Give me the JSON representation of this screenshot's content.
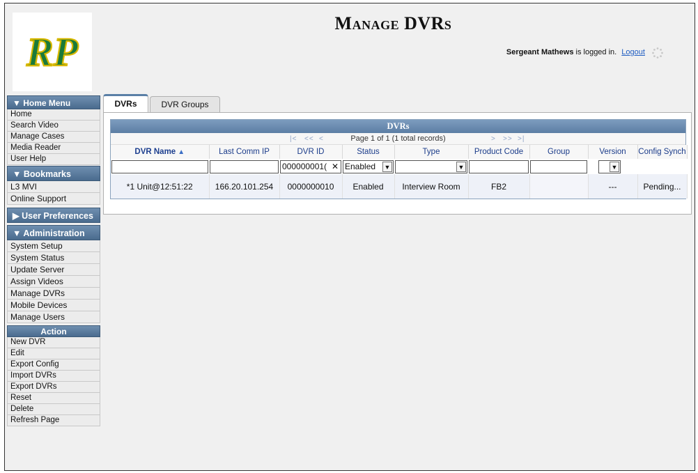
{
  "page": {
    "title": "Manage DVRs"
  },
  "brand": {
    "logo_text": "RP",
    "logo_color": "#1a7a3a",
    "logo_outline": "#d8b800"
  },
  "session": {
    "user": "Sergeant Mathews",
    "suffix": " is logged in.",
    "logout": "Logout"
  },
  "sidebar": {
    "home_menu": {
      "title": "▼ Home Menu",
      "items": [
        "Home",
        "Search Video",
        "Manage Cases",
        "Media Reader",
        "User Help"
      ]
    },
    "bookmarks": {
      "title": "▼  Bookmarks",
      "items": [
        "L3 MVI",
        "Online Support"
      ]
    },
    "user_prefs": {
      "title": "▶ User Preferences"
    },
    "administration": {
      "title": "▼ Administration",
      "items": [
        "System Setup",
        "System Status",
        "Update Server",
        "Assign Videos",
        "Manage DVRs",
        "Mobile Devices",
        "Manage Users"
      ]
    },
    "action": {
      "title": "Action",
      "items": [
        "New DVR",
        "Edit",
        "Export Config",
        "Import DVRs",
        "Export DVRs",
        "Reset",
        "Delete",
        "Refresh Page"
      ]
    }
  },
  "tabs": [
    "DVRs",
    "DVR Groups"
  ],
  "grid": {
    "title": "DVRs",
    "pager": {
      "first": "|<",
      "prev_group": "<<",
      "prev": "<",
      "text": "Page 1 of 1 (1 total records)",
      "next": ">",
      "next_group": ">>",
      "last": ">|"
    },
    "columns": [
      "DVR Name",
      "Last Comm IP",
      "DVR ID",
      "Status",
      "Type",
      "Product Code",
      "Group",
      "Version",
      "Config Synch"
    ],
    "sort_arrow": "▲",
    "filters": {
      "dvr_id": "000000001(",
      "status": "Enabled"
    },
    "rows": [
      {
        "dvr_name": "*1 Unit@12:51:22",
        "last_comm_ip": "166.20.101.254",
        "dvr_id": "0000000010",
        "status": "Enabled",
        "type": "Interview Room",
        "product_code": "FB2",
        "group": "",
        "version": "---",
        "config_synch": "Pending..."
      }
    ]
  },
  "colors": {
    "header_blue": "#5c7ea4",
    "link_blue": "#1f5dc2",
    "row_bg": "#eef1f8"
  }
}
